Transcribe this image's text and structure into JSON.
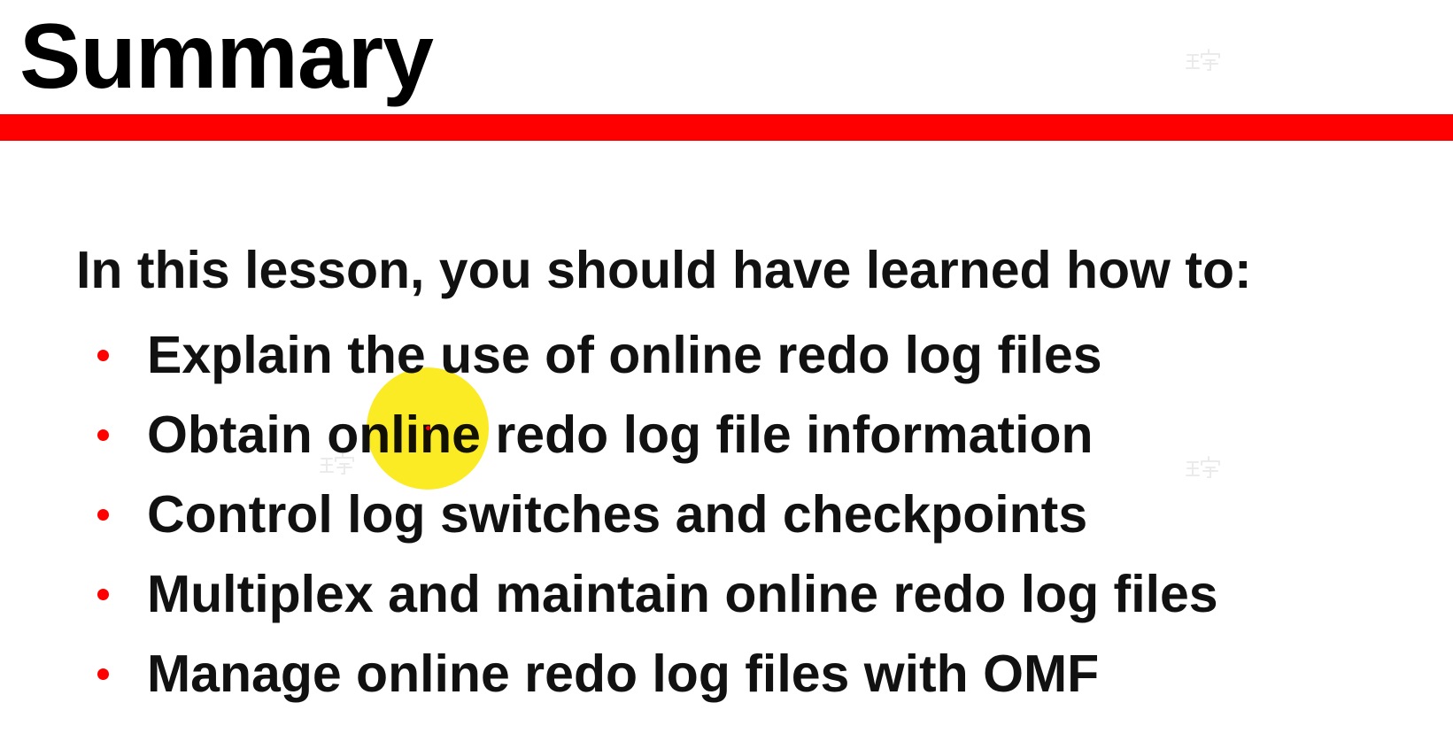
{
  "slide": {
    "title": "Summary",
    "intro": "In this lesson, you should have learned how to:",
    "bullets": [
      "Explain the use of online redo log files",
      "Obtain online redo log file information",
      "Control log switches and checkpoints",
      "Multiplex and maintain online redo log files",
      "Manage online redo log files with OMF"
    ]
  },
  "icons": {
    "cursor": "cursor-highlight-icon",
    "watermark": "watermark-icon"
  },
  "colors": {
    "accent_rule": "#ff0000",
    "bullet": "#ff0000",
    "highlight": "#f9e400",
    "cursor_dot": "#ff0000",
    "watermark": "#c8c8c8"
  }
}
